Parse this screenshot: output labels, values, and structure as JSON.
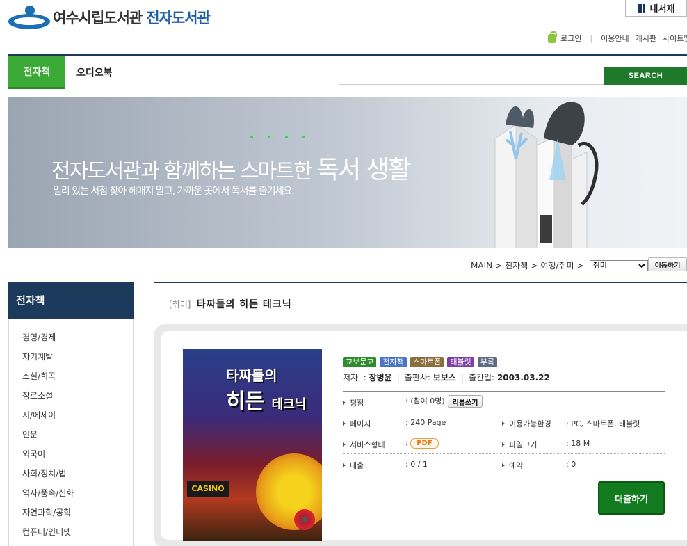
{
  "header": {
    "logo_name": "여수시립도서관",
    "logo_sub": "전자도서관",
    "mylib_label": "내서재",
    "toplinks": {
      "login": "로그인",
      "guide": "이용안내",
      "board": "게시판",
      "sitemap": "사이트맵"
    }
  },
  "nav": {
    "tabs": [
      {
        "label": "전자책",
        "active": true
      },
      {
        "label": "오디오북",
        "active": false
      }
    ],
    "search": {
      "value": "",
      "placeholder": "",
      "button_label": "SEARCH"
    },
    "accent_color": "#3aa935"
  },
  "banner": {
    "headline_small": "전자도서관과 함께하는 스마트한",
    "headline_big": "독서 생활",
    "subline": "멀리 있는 서점 찾아 헤매지 말고, 가까운 곳에서 독서를 즐기세요."
  },
  "breadcrumb": {
    "items": [
      "MAIN",
      "전자책",
      "여행/취미"
    ],
    "separator": ">",
    "select_value": "취미",
    "move_button": "이동하기"
  },
  "sidebar": {
    "title": "전자책",
    "items": [
      "경영/경제",
      "자기계발",
      "소설/희곡",
      "장르소설",
      "시/에세이",
      "인문",
      "외국어",
      "사회/정치/법",
      "역사/풍속/신화",
      "자연과학/공학",
      "컴퓨터/인터넷"
    ]
  },
  "book": {
    "category": "[취미]",
    "title": "타짜들의 히든 테크닉",
    "cover": {
      "title_line": "타짜들의",
      "big_a": "히든",
      "big_b": "테크닉",
      "casino": "CASINO"
    },
    "badges": [
      {
        "label": "교보문고",
        "color": "#2e8b2e"
      },
      {
        "label": "전자책",
        "color": "#4a76c6"
      },
      {
        "label": "스마트폰",
        "color": "#8c6d3c"
      },
      {
        "label": "태블릿",
        "color": "#7d3fa8"
      },
      {
        "label": "부록",
        "color": "#5f6b86"
      }
    ],
    "author_label": "저자",
    "author": "장병윤",
    "publisher_label": "출판사:",
    "publisher": "보보스",
    "pubdate_label": "출간일:",
    "pubdate": "2003.03.22",
    "info": {
      "rating_label": "평점",
      "rating_value": ": (참여 0명)",
      "review_button": "리뷰쓰기",
      "pages_label": "페이지",
      "pages_value": ": 240 Page",
      "env_label": "이용가능환경",
      "env_value": ": PC, 스마트폰, 태블릿",
      "service_label": "서비스형태",
      "service_colon": ":",
      "service_value": "PDF",
      "filesize_label": "파일크기",
      "filesize_value": ": 18 M",
      "loan_label": "대출",
      "loan_value": ": 0 / 1",
      "reserve_label": "예약",
      "reserve_value": ": 0"
    },
    "borrow_button": "대출하기"
  }
}
